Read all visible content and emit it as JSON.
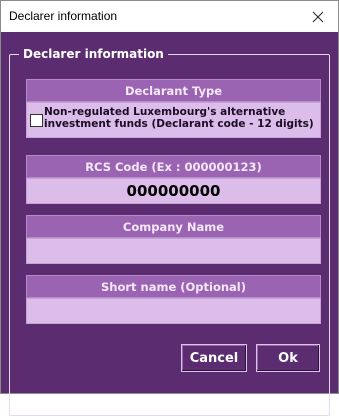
{
  "window": {
    "title": "Declarer information"
  },
  "group": {
    "legend": "Declarer information"
  },
  "declarant_type": {
    "header": "Declarant Type",
    "checkbox_label": "Non-regulated Luxembourg's alternative investment funds (Declarant code - 12 digits)",
    "checked": false
  },
  "rcs_code": {
    "header": "RCS Code (Ex : 000000123)",
    "value": "000000000"
  },
  "company_name": {
    "header": "Company Name",
    "value": ""
  },
  "short_name": {
    "header": "Short name (Optional)",
    "value": ""
  },
  "buttons": {
    "cancel": "Cancel",
    "ok": "Ok"
  },
  "colors": {
    "panel": "#5b2c6f",
    "header": "#9a64b3",
    "field": "#dcbdea"
  }
}
